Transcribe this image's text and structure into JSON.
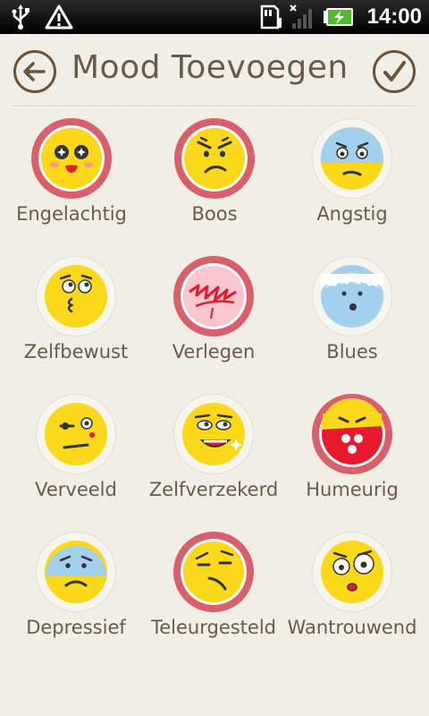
{
  "status_bar": {
    "time": "14:00",
    "icons": [
      "usb-icon",
      "warning-icon",
      "sd-card-icon",
      "no-signal-icon",
      "battery-charging-icon"
    ]
  },
  "header": {
    "title": "Mood Toevoegen",
    "back_icon": "back-arrow-icon",
    "confirm_icon": "checkmark-icon"
  },
  "moods": [
    {
      "label": "Engelachtig",
      "icon": "angelic-face-icon",
      "selected": true
    },
    {
      "label": "Boos",
      "icon": "angry-face-icon",
      "selected": true
    },
    {
      "label": "Angstig",
      "icon": "anxious-face-icon",
      "selected": false
    },
    {
      "label": "Zelfbewust",
      "icon": "self-conscious-face-icon",
      "selected": false
    },
    {
      "label": "Verlegen",
      "icon": "shy-face-icon",
      "selected": true
    },
    {
      "label": "Blues",
      "icon": "blues-face-icon",
      "selected": false
    },
    {
      "label": "Verveeld",
      "icon": "bored-face-icon",
      "selected": false
    },
    {
      "label": "Zelfverzekerd",
      "icon": "confident-face-icon",
      "selected": false
    },
    {
      "label": "Humeurig",
      "icon": "moody-face-icon",
      "selected": true
    },
    {
      "label": "Depressief",
      "icon": "depressed-face-icon",
      "selected": false
    },
    {
      "label": "Teleurgesteld",
      "icon": "disappointed-face-icon",
      "selected": true
    },
    {
      "label": "Wantrouwend",
      "icon": "suspicious-face-icon",
      "selected": false
    }
  ]
}
